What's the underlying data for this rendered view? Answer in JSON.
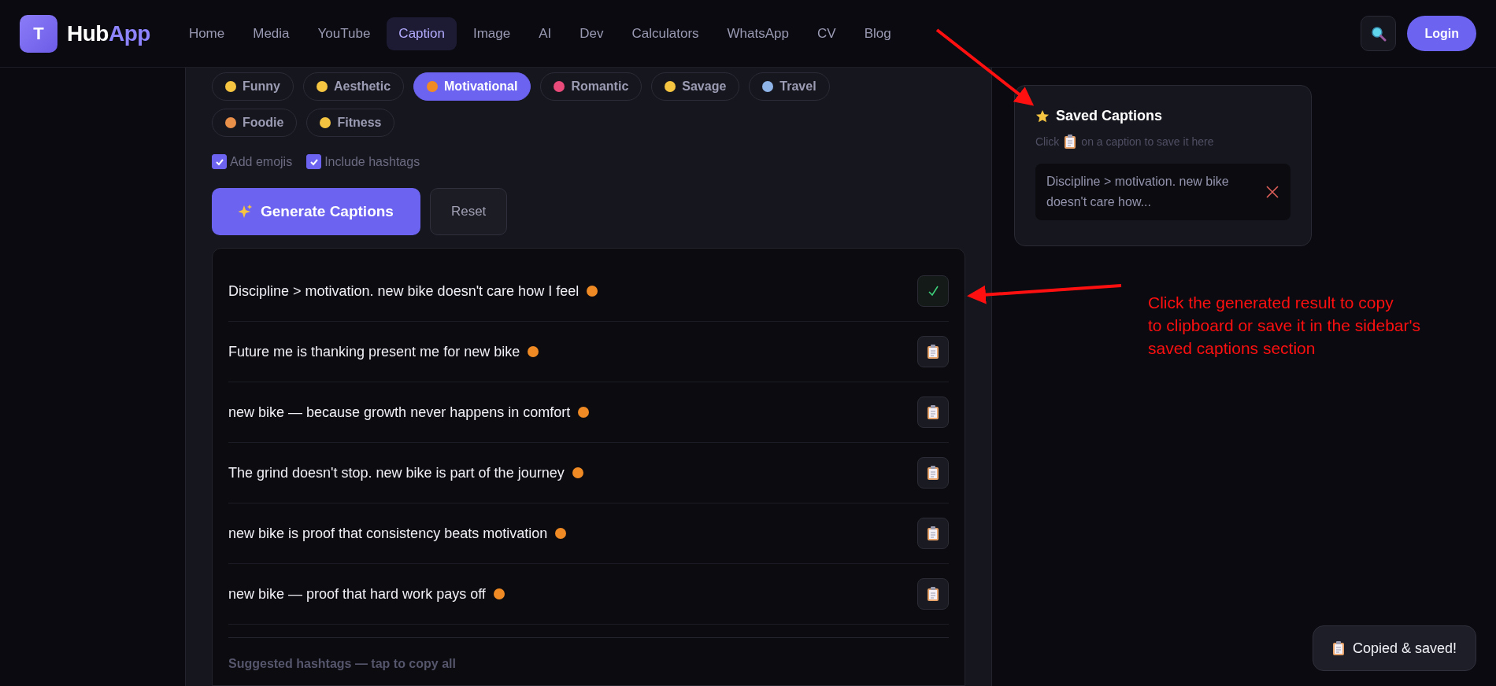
{
  "header": {
    "logo_letter": "T",
    "brand": "Hub",
    "brand_accent": "App",
    "nav": [
      {
        "label": "Home",
        "selected": false
      },
      {
        "label": "Media",
        "selected": false
      },
      {
        "label": "YouTube",
        "selected": false
      },
      {
        "label": "Caption",
        "selected": true
      },
      {
        "label": "Image",
        "selected": false
      },
      {
        "label": "AI",
        "selected": false
      },
      {
        "label": "Dev",
        "selected": false
      },
      {
        "label": "Calculators",
        "selected": false
      },
      {
        "label": "WhatsApp",
        "selected": false
      },
      {
        "label": "CV",
        "selected": false
      },
      {
        "label": "Blog",
        "selected": false
      }
    ],
    "login": "Login"
  },
  "tones": [
    {
      "label": "Funny",
      "selected": false
    },
    {
      "label": "Aesthetic",
      "selected": false
    },
    {
      "label": "Motivational",
      "selected": true
    },
    {
      "label": "Romantic",
      "selected": false
    },
    {
      "label": "Savage",
      "selected": false
    },
    {
      "label": "Travel",
      "selected": false
    },
    {
      "label": "Foodie",
      "selected": false
    },
    {
      "label": "Fitness",
      "selected": false
    }
  ],
  "options": [
    {
      "label": "Add emojis",
      "checked": true
    },
    {
      "label": "Include hashtags",
      "checked": true
    }
  ],
  "generate_button": "Generate Captions",
  "reset_button": "Reset",
  "results": [
    {
      "text": "Discipline > motivation. new bike doesn't care how I feel",
      "copied": true
    },
    {
      "text": "Future me is thanking present me for new bike",
      "copied": false
    },
    {
      "text": "new bike — because growth never happens in comfort",
      "copied": false
    },
    {
      "text": "The grind doesn't stop. new bike is part of the journey",
      "copied": false
    },
    {
      "text": "new bike is proof that consistency beats motivation",
      "copied": false
    },
    {
      "text": "new bike — proof that hard work pays off",
      "copied": false
    }
  ],
  "hashtags_hint": "Suggested hashtags — tap to copy all",
  "saved": {
    "title": "Saved Captions",
    "hint_before": "Click",
    "hint_after": "on a caption to save it here",
    "items": [
      {
        "text": "Discipline > motivation. new bike doesn't care how..."
      }
    ]
  },
  "annotation": {
    "lines": [
      "Click the generated result to copy",
      "to clipboard or save it in the sidebar's",
      "saved captions section"
    ]
  },
  "toast": "Copied & saved!"
}
